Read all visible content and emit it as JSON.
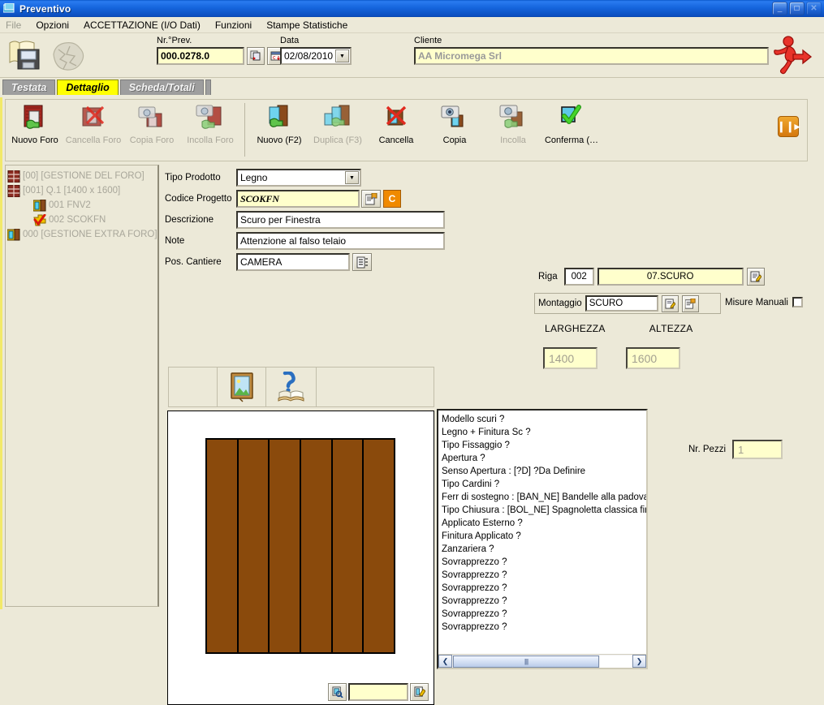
{
  "window": {
    "title": "Preventivo",
    "icon": "window-app-icon",
    "buttons": {
      "minimize": "_",
      "maximize": "□",
      "close": "✕"
    }
  },
  "menu": {
    "items": [
      {
        "label": "File",
        "disabled": true
      },
      {
        "label": "Opzioni",
        "disabled": false
      },
      {
        "label": "ACCETTAZIONE (I/O Dati)",
        "disabled": false
      },
      {
        "label": "Funzioni",
        "disabled": false
      },
      {
        "label": "Stampe Statistiche",
        "disabled": false
      }
    ]
  },
  "header": {
    "nr_prev_label": "Nr.°Prev.",
    "nr_prev_value": "000.0278.0",
    "data_label": "Data",
    "data_value": "02/08/2010",
    "cliente_label": "Cliente",
    "cliente_value": "AA Micromega Srl"
  },
  "tabs": [
    {
      "label": "Testata",
      "active": false
    },
    {
      "label": "Dettaglio",
      "active": true
    },
    {
      "label": "Scheda/Totali",
      "active": false
    }
  ],
  "toolbar": {
    "items": [
      {
        "label": "Nuovo Foro",
        "icon": "new-hole-icon",
        "disabled": false
      },
      {
        "label": "Cancella Foro",
        "icon": "delete-hole-icon",
        "disabled": true
      },
      {
        "label": "Copia Foro",
        "icon": "copy-hole-icon",
        "disabled": true
      },
      {
        "label": "Incolla Foro",
        "icon": "paste-hole-icon",
        "disabled": true
      },
      {
        "label": "Nuovo (F2)",
        "icon": "new-item-icon",
        "disabled": false
      },
      {
        "label": "Duplica (F3)",
        "icon": "duplicate-item-icon",
        "disabled": true
      },
      {
        "label": "Cancella",
        "icon": "delete-item-icon",
        "disabled": false
      },
      {
        "label": "Copia",
        "icon": "copy-item-icon",
        "disabled": false
      },
      {
        "label": "Incolla",
        "icon": "paste-item-icon",
        "disabled": true
      },
      {
        "label": "Conferma (…",
        "icon": "confirm-check-icon",
        "disabled": false
      }
    ],
    "expand_icon": "expand-panel-icon"
  },
  "tree": {
    "items": [
      {
        "label": "[00]  [GESTIONE DEL FORO]",
        "icon": "hole-node-icon",
        "indent": 0
      },
      {
        "label": "[001]  Q.1 [1400 x 1600]",
        "icon": "hole-node-icon",
        "indent": 0
      },
      {
        "label": "001     FNV2",
        "icon": "window-node-icon",
        "indent": 2
      },
      {
        "label": "002     SCOKFN",
        "icon": "check-node-icon",
        "indent": 2
      },
      {
        "label": "000  [GESTIONE EXTRA FORO]",
        "icon": "extra-node-icon",
        "indent": 0
      }
    ]
  },
  "form": {
    "tipo_prodotto_label": "Tipo Prodotto",
    "tipo_prodotto_value": "Legno",
    "codice_progetto_label": "Codice Progetto",
    "codice_progetto_value": "SCOKFN",
    "codice_button_label": "C",
    "descrizione_label": "Descrizione",
    "descrizione_value": "Scuro per Finestra",
    "note_label": "Note",
    "note_value": "Attenzione al falso telaio",
    "pos_cantiere_label": "Pos. Cantiere",
    "pos_cantiere_value": "CAMERA"
  },
  "right": {
    "riga_label": "Riga",
    "riga_number": "002",
    "riga_desc": "07.SCURO",
    "montaggio_label": "Montaggio",
    "montaggio_value": "SCURO",
    "misure_manuali_label": "Misure Manuali",
    "misure_manuali_checked": false,
    "larghezza_label": "LARGHEZZA",
    "larghezza_value": "1400",
    "altezza_label": "ALTEZZA",
    "altezza_value": "1600",
    "nr_pezzi_label": "Nr. Pezzi",
    "nr_pezzi_value": "1"
  },
  "icon_tabs": [
    {
      "icon": "picture-frame-icon"
    },
    {
      "icon": "help-book-icon"
    }
  ],
  "drawing": {
    "slat_count": 6,
    "slat_color": "#8a4a0c",
    "zoom_icon": "zoom-drawing-icon",
    "input_value": "",
    "edit_icon": "edit-drawing-icon"
  },
  "options_list": {
    "items": [
      "Modello scuri ?",
      "Legno + Finitura Sc ?",
      "Tipo Fissaggio ?",
      "Apertura ?",
      "Senso Apertura : [?D] ?Da Definire",
      "Tipo Cardini ?",
      "Ferr di sostegno : [BAN_NE] Bandelle alla padovana n",
      "Tipo Chiusura : [BOL_NE] Spagnoletta classica finitura",
      "Applicato Esterno ?",
      "Finitura Applicato ?",
      "Zanzariera ?",
      "Sovrapprezzo ?",
      "Sovrapprezzo ?",
      "Sovrapprezzo ?",
      "Sovrapprezzo ?",
      "Sovrapprezzo ?",
      "Sovrapprezzo ?"
    ],
    "scroll_left_icon": "❮",
    "scroll_right_icon": "❯",
    "thumb_grip": "||||"
  }
}
